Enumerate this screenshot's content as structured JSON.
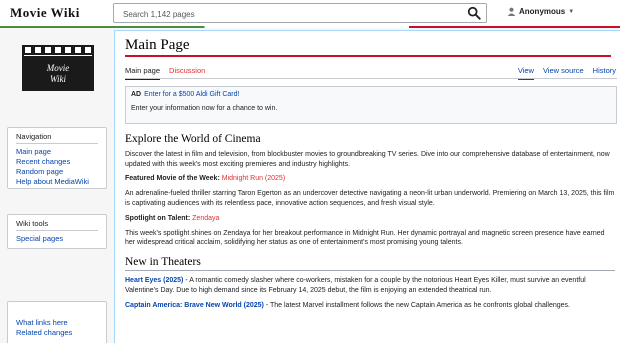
{
  "header": {
    "logo_text": "Movie Wiki",
    "search_placeholder": "Search 1,142 pages",
    "user_name": "Anonymous"
  },
  "sidebar": {
    "logo_line1": "Movie",
    "logo_line2": "Wiki",
    "navigation": {
      "title": "Navigation",
      "items": [
        "Main page",
        "Recent changes",
        "Random page",
        "Help about MediaWiki"
      ]
    },
    "tools": {
      "title": "Wiki tools",
      "items": [
        "Special pages"
      ]
    },
    "page_tools": {
      "items": [
        "What links here",
        "Related changes"
      ]
    }
  },
  "page": {
    "title": "Main Page",
    "tabs_left": [
      "Main page",
      "Discussion"
    ],
    "tabs_right": [
      "View",
      "View source",
      "History"
    ],
    "ad": {
      "tag": "AD",
      "link": "Enter for a $500 Aldi Gift Card!",
      "sub": "Enter your information now for a chance to win."
    },
    "h_explore": "Explore the World of Cinema",
    "intro": "Discover the latest in film and television, from blockbuster movies to groundbreaking TV series. Dive into our comprehensive database of entertainment, now updated with this week's most exciting premieres and industry highlights.",
    "featured_label": "Featured Movie of the Week:",
    "featured_link": "Midnight Run (2025)",
    "featured_text": "An adrenaline-fueled thriller starring Taron Egerton as an undercover detective navigating a neon-lit urban underworld. Premiering on March 13, 2025, this film is captivating audiences with its relentless pace, innovative action sequences, and fresh visual style.",
    "spotlight_label": "Spotlight on Talent:",
    "spotlight_link": "Zendaya",
    "spotlight_text": "This week's spotlight shines on Zendaya for her breakout performance in Midnight Run. Her dynamic portrayal and magnetic screen presence have earned her widespread critical acclaim, solidifying her status as one of entertainment's most promising young talents.",
    "h_theaters": "New in Theaters",
    "theater1_link": "Heart Eyes (2025)",
    "theater1_text": " - A romantic comedy slasher where co-workers, mistaken for a couple by the notorious Heart Eyes Killer, must survive an eventful Valentine's Day. Due to high demand since its February 14, 2025 debut, the film is enjoying an extended theatrical run.",
    "theater2_link": "Captain America: Brave New World (2025)",
    "theater2_text": " - The latest Marvel installment follows the new Captain America as he confronts global challenges."
  },
  "colors": {
    "link": "#0645ad",
    "new_link": "#d33",
    "accent_red": "#c8102e",
    "accent_green": "#4c8c3a"
  }
}
